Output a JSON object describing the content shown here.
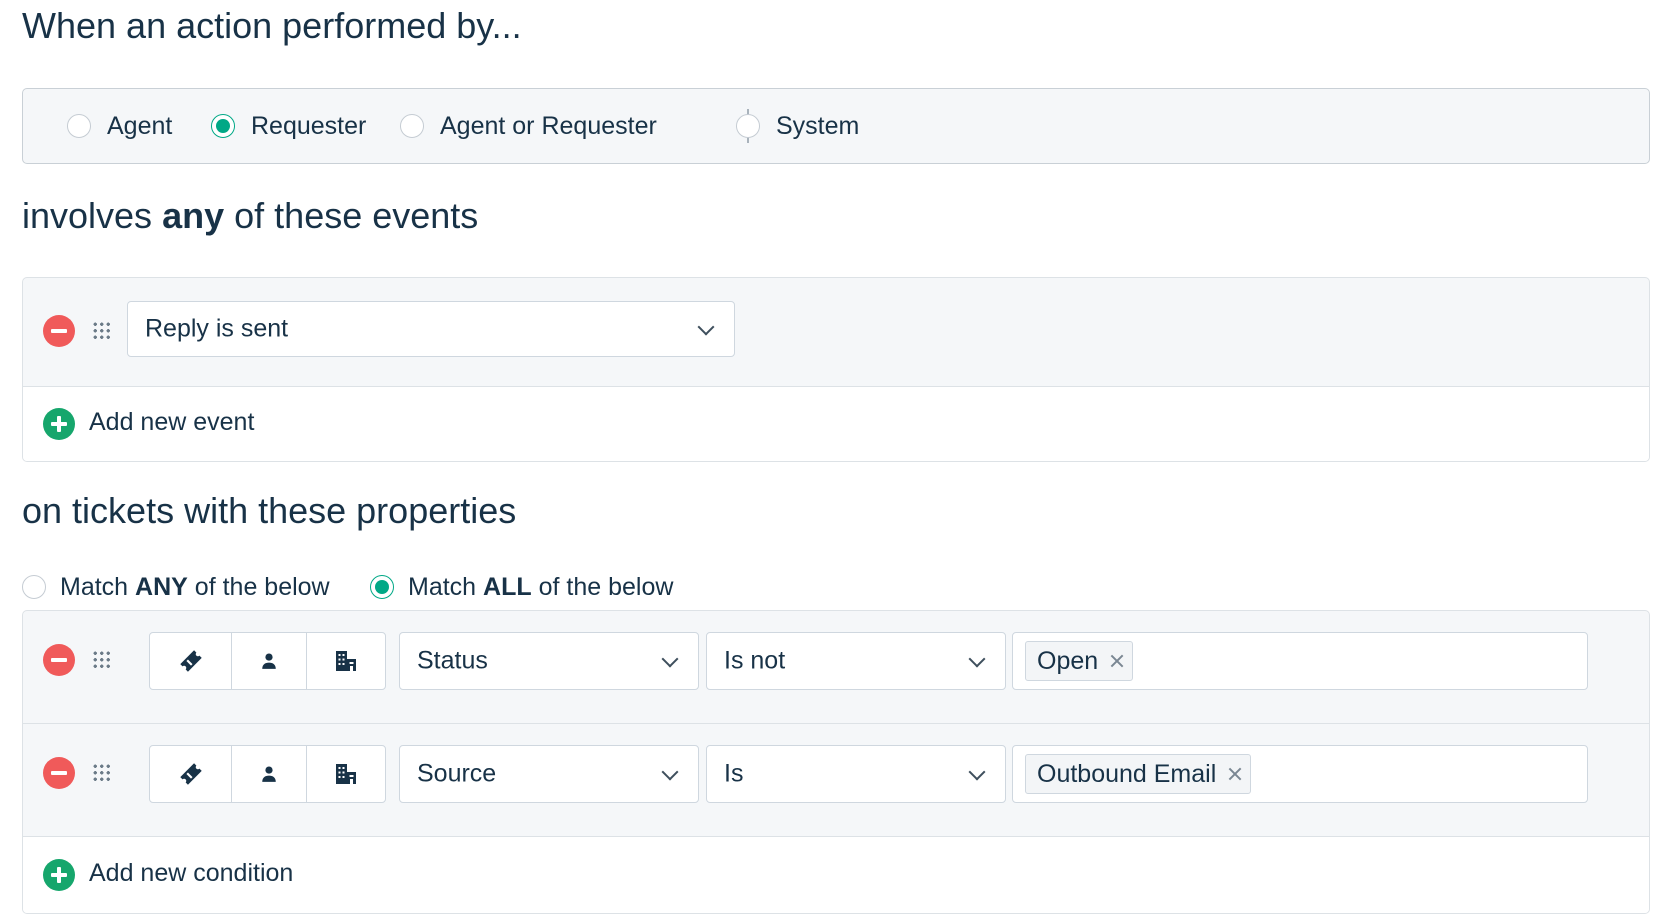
{
  "performer": {
    "heading": "When an action performed by...",
    "options": [
      {
        "label": "Agent",
        "selected": false
      },
      {
        "label": "Requester",
        "selected": true
      },
      {
        "label": "Agent or Requester",
        "selected": false
      },
      {
        "label": "System",
        "selected": false
      }
    ]
  },
  "events": {
    "heading_pre": "involves",
    "heading_bold": "any",
    "heading_post": "of these events",
    "rows": [
      {
        "value": "Reply is sent"
      }
    ],
    "add_label": "Add new event"
  },
  "conditions": {
    "heading": "on tickets with these properties",
    "match_any": {
      "pre": "Match",
      "bold": "ANY",
      "post": "of the below",
      "selected": false
    },
    "match_all": {
      "pre": "Match",
      "bold": "ALL",
      "post": "of the below",
      "selected": true
    },
    "segment_icons": [
      "ticket-icon",
      "contact-icon",
      "company-icon"
    ],
    "rows": [
      {
        "field": "Status",
        "operator": "Is not",
        "tags": [
          "Open"
        ]
      },
      {
        "field": "Source",
        "operator": "Is",
        "tags": [
          "Outbound Email"
        ]
      }
    ],
    "add_label": "Add new condition"
  },
  "colors": {
    "text": "#183247",
    "accent_green": "#00a886",
    "remove_red": "#f05a5a",
    "add_green": "#16a66c",
    "panel_bg": "#f5f7f9"
  }
}
